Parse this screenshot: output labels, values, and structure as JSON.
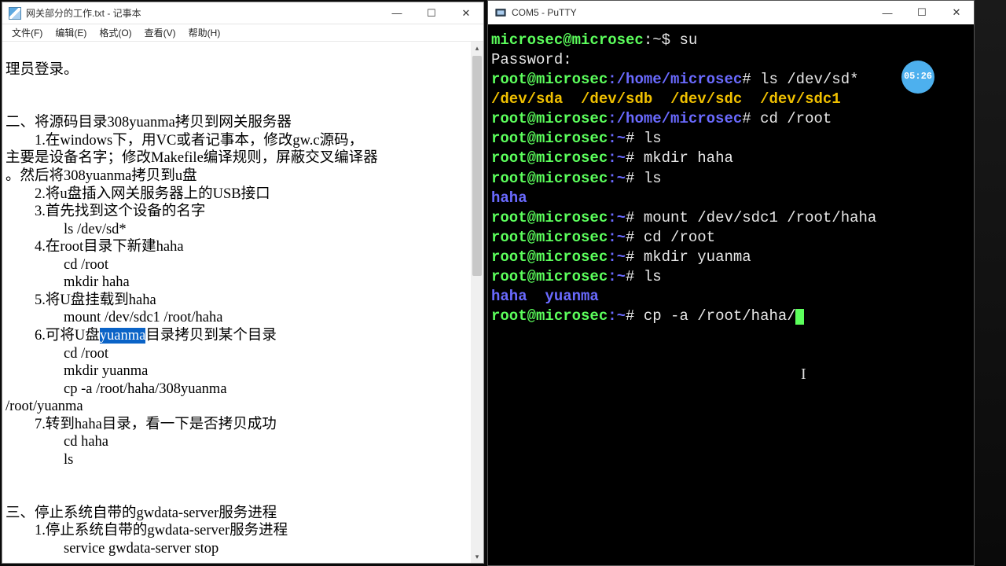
{
  "notepad": {
    "title": "网关部分的工作.txt - 记事本",
    "menu": [
      "文件(F)",
      "编辑(E)",
      "格式(O)",
      "查看(V)",
      "帮助(H)"
    ],
    "ctrl": {
      "min": "—",
      "max": "☐",
      "close": "✕"
    },
    "selection": "yuanma",
    "lines": {
      "l00": "理员登录。",
      "l01": "",
      "l02": "",
      "l03": "二、将源码目录308yuanma拷贝到网关服务器",
      "l04": "        1.在windows下，用VC或者记事本，修改gw.c源码，",
      "l05": "主要是设备名字；修改Makefile编译规则，屏蔽交叉编译器",
      "l06": "。然后将308yuanma拷贝到u盘",
      "l07": "        2.将u盘插入网关服务器上的USB接口",
      "l08": "        3.首先找到这个设备的名字",
      "l09": "                ls /dev/sd*",
      "l10": "        4.在root目录下新建haha",
      "l11": "                cd /root",
      "l12": "                mkdir haha",
      "l13": "        5.将U盘挂载到haha",
      "l14": "                mount /dev/sdc1 /root/haha",
      "l15a": "        6.可将U盘",
      "l15b": "目录拷贝到某个目录",
      "l16": "                cd /root",
      "l17": "                mkdir yuanma",
      "l18": "                cp -a /root/haha/308yuanma",
      "l19": "/root/yuanma",
      "l20": "        7.转到haha目录，看一下是否拷贝成功",
      "l21": "                cd haha",
      "l22": "                ls",
      "l23": "",
      "l24": "",
      "l25": "三、停止系统自带的gwdata-server服务进程",
      "l26": "        1.停止系统自带的gwdata-server服务进程",
      "l27": "                service gwdata-server stop"
    }
  },
  "putty": {
    "title": "COM5 - PuTTY",
    "ctrl": {
      "min": "—",
      "max": "☐",
      "close": "✕"
    },
    "badge": "05:26",
    "p_user": "microsec@microsec",
    "p_root": "root@microsec",
    "home_path": ":/home/microsec",
    "tilde": ":~",
    "dollar": "$",
    "hash": "#",
    "cmds": {
      "su": " su",
      "pw": "Password:",
      "ls_sd": " ls /dev/sd*",
      "sda": "/dev/sda",
      "sdb": "/dev/sdb",
      "sdc": "/dev/sdc",
      "sdc1": "/dev/sdc1",
      "cd_root": " cd /root",
      "ls": " ls",
      "mkdir_haha": " mkdir haha",
      "haha": "haha",
      "mount": " mount /dev/sdc1 /root/haha",
      "mkdir_y": " mkdir yuanma",
      "yuanma": "yuanma",
      "cp": " cp -a /root/haha/"
    }
  }
}
